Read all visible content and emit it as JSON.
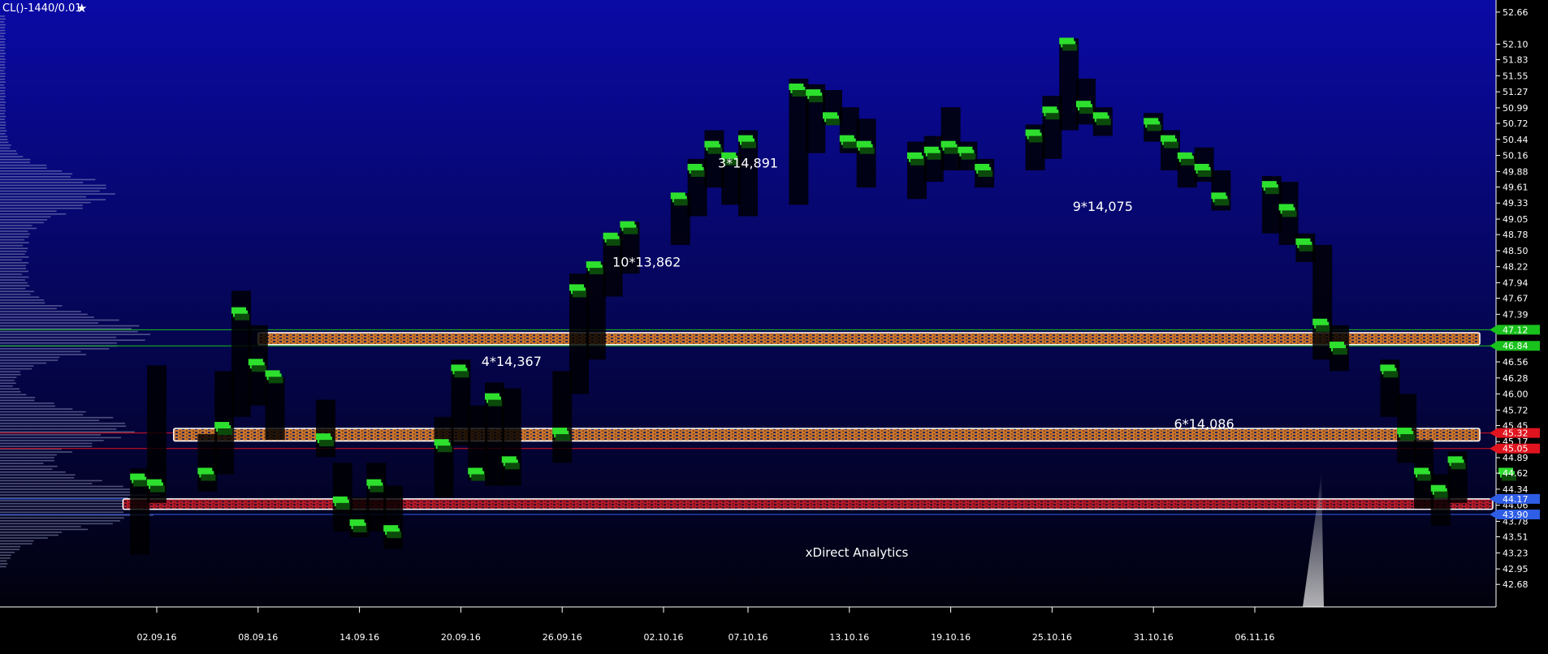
{
  "header": {
    "symbol": "CL()-1440/0.01",
    "star_icon": "star-icon"
  },
  "watermark": "xDirect Analytics",
  "colors": {
    "bg_top": "#0a0aa6",
    "bg_bottom": "#01010c",
    "candle_green": "#2ee02e",
    "candle_dark": "#0b4a0b",
    "zone_orange": "#d07a30",
    "zone_red": "#b31b27",
    "tag_green": "#19c11c",
    "tag_red": "#e0141e",
    "tag_blue": "#2e5de6"
  },
  "chart_data": {
    "type": "candlestick",
    "y_axis": {
      "range": [
        42.4,
        52.8
      ],
      "ticks": [
        "52.66",
        "52.10",
        "51.83",
        "51.55",
        "51.27",
        "50.99",
        "50.72",
        "50.44",
        "50.16",
        "49.88",
        "49.61",
        "49.33",
        "49.05",
        "48.78",
        "48.50",
        "48.22",
        "47.94",
        "47.67",
        "47.39",
        "47.12",
        "46.84",
        "46.56",
        "46.28",
        "46.00",
        "45.72",
        "45.45",
        "45.17",
        "44.89",
        "44.62",
        "44.34",
        "44.06",
        "43.78",
        "43.51",
        "43.23",
        "42.95",
        "42.68"
      ]
    },
    "x_axis": {
      "dates": [
        "02.09.16",
        "08.09.16",
        "14.09.16",
        "20.09.16",
        "26.09.16",
        "02.10.16",
        "07.10.16",
        "13.10.16",
        "19.10.16",
        "25.10.16",
        "31.10.16",
        "06.11.16"
      ]
    },
    "bars": [
      {
        "low": 43.2,
        "high": 44.7,
        "vol": 44.5
      },
      {
        "low": 44.1,
        "high": 46.5,
        "vol": 44.4
      },
      {
        "low": 44.3,
        "high": 45.3,
        "vol": 44.6
      },
      {
        "low": 44.6,
        "high": 46.4,
        "vol": 45.4
      },
      {
        "low": 45.6,
        "high": 47.8,
        "vol": 47.4
      },
      {
        "low": 45.8,
        "high": 47.2,
        "vol": 46.5
      },
      {
        "low": 45.2,
        "high": 46.3,
        "vol": 46.3
      },
      {
        "low": 44.9,
        "high": 45.9,
        "vol": 45.2
      },
      {
        "low": 43.6,
        "high": 44.8,
        "vol": 44.1
      },
      {
        "low": 43.5,
        "high": 44.2,
        "vol": 43.7
      },
      {
        "low": 43.6,
        "high": 44.8,
        "vol": 44.4
      },
      {
        "low": 43.3,
        "high": 44.4,
        "vol": 43.6
      },
      {
        "low": 44.2,
        "high": 45.6,
        "vol": 45.1
      },
      {
        "low": 45.1,
        "high": 46.6,
        "vol": 46.4
      },
      {
        "low": 44.5,
        "high": 45.8,
        "vol": 44.6
      },
      {
        "low": 44.4,
        "high": 46.2,
        "vol": 45.9
      },
      {
        "low": 44.4,
        "high": 46.1,
        "vol": 44.8
      },
      {
        "low": 44.8,
        "high": 46.4,
        "vol": 45.3
      },
      {
        "low": 46.0,
        "high": 48.1,
        "vol": 47.8
      },
      {
        "low": 46.6,
        "high": 48.3,
        "vol": 48.2
      },
      {
        "low": 47.7,
        "high": 48.8,
        "vol": 48.7
      },
      {
        "low": 48.1,
        "high": 49.0,
        "vol": 48.9
      },
      {
        "low": 48.6,
        "high": 49.5,
        "vol": 49.4
      },
      {
        "low": 49.1,
        "high": 50.1,
        "vol": 49.9
      },
      {
        "low": 49.6,
        "high": 50.6,
        "vol": 50.3
      },
      {
        "low": 49.3,
        "high": 50.2,
        "vol": 50.1
      },
      {
        "low": 49.1,
        "high": 50.6,
        "vol": 50.4
      },
      {
        "low": 49.3,
        "high": 51.5,
        "vol": 51.3
      },
      {
        "low": 50.2,
        "high": 51.4,
        "vol": 51.2
      },
      {
        "low": 50.7,
        "high": 51.3,
        "vol": 50.8
      },
      {
        "low": 50.2,
        "high": 51.0,
        "vol": 50.4
      },
      {
        "low": 49.6,
        "high": 50.8,
        "vol": 50.3
      },
      {
        "low": 49.4,
        "high": 50.4,
        "vol": 50.1
      },
      {
        "low": 49.7,
        "high": 50.5,
        "vol": 50.2
      },
      {
        "low": 49.9,
        "high": 51.0,
        "vol": 50.3
      },
      {
        "low": 49.9,
        "high": 50.4,
        "vol": 50.2
      },
      {
        "low": 49.6,
        "high": 50.1,
        "vol": 49.9
      },
      {
        "low": 49.9,
        "high": 50.7,
        "vol": 50.5
      },
      {
        "low": 50.1,
        "high": 51.2,
        "vol": 50.9
      },
      {
        "low": 50.6,
        "high": 52.2,
        "vol": 52.1
      },
      {
        "low": 50.7,
        "high": 51.5,
        "vol": 51.0
      },
      {
        "low": 50.5,
        "high": 51.0,
        "vol": 50.8
      },
      {
        "low": 50.4,
        "high": 50.9,
        "vol": 50.7
      },
      {
        "low": 49.9,
        "high": 50.6,
        "vol": 50.4
      },
      {
        "low": 49.6,
        "high": 50.2,
        "vol": 50.1
      },
      {
        "low": 49.7,
        "high": 50.3,
        "vol": 49.9
      },
      {
        "low": 49.2,
        "high": 49.9,
        "vol": 49.4
      },
      {
        "low": 48.8,
        "high": 49.8,
        "vol": 49.6
      },
      {
        "low": 48.6,
        "high": 49.7,
        "vol": 49.2
      },
      {
        "low": 48.3,
        "high": 48.8,
        "vol": 48.6
      },
      {
        "low": 46.6,
        "high": 48.6,
        "vol": 47.2
      },
      {
        "low": 46.4,
        "high": 47.2,
        "vol": 46.8
      },
      {
        "low": 45.6,
        "high": 46.6,
        "vol": 46.4
      },
      {
        "low": 44.8,
        "high": 46.0,
        "vol": 45.3
      },
      {
        "low": 44.0,
        "high": 45.2,
        "vol": 44.6
      },
      {
        "low": 43.7,
        "high": 44.6,
        "vol": 44.3
      },
      {
        "low": 44.1,
        "high": 45.0,
        "vol": 44.8
      },
      {
        "low": 44.4,
        "high": 45.1,
        "vol": 44.6
      }
    ],
    "annotations": [
      {
        "text": "10*13,862",
        "x": "01.10.16",
        "y": 48.22
      },
      {
        "text": "3*14,891",
        "x": "07.10.16",
        "y": 49.95
      },
      {
        "text": "9*14,075",
        "x": "28.10.16",
        "y": 49.19
      },
      {
        "text": "4*14,367",
        "x": "23.09.16",
        "y": 46.49
      },
      {
        "text": "6*14,086",
        "x": "03.11.16",
        "y": 45.4
      }
    ],
    "zones": [
      {
        "name": "zone-47",
        "low": 46.86,
        "high": 47.07,
        "color": "orange",
        "from": "08.09.16"
      },
      {
        "name": "zone-45",
        "low": 45.18,
        "high": 45.4,
        "color": "orange",
        "from": "03.09.16"
      },
      {
        "name": "zone-44",
        "low": 43.99,
        "high": 44.17,
        "color": "red",
        "from": "31.08.16"
      }
    ],
    "levels": [
      {
        "label": "47.12",
        "color": "green"
      },
      {
        "label": "46.84",
        "color": "green"
      },
      {
        "label": "45.32",
        "color": "red"
      },
      {
        "label": "45.05",
        "color": "red"
      },
      {
        "label": "44.17",
        "color": "blue"
      },
      {
        "label": "43.90",
        "color": "blue"
      }
    ],
    "volume_profile_peaks": [
      49.55,
      47.05,
      45.4,
      44.3,
      43.95
    ]
  }
}
